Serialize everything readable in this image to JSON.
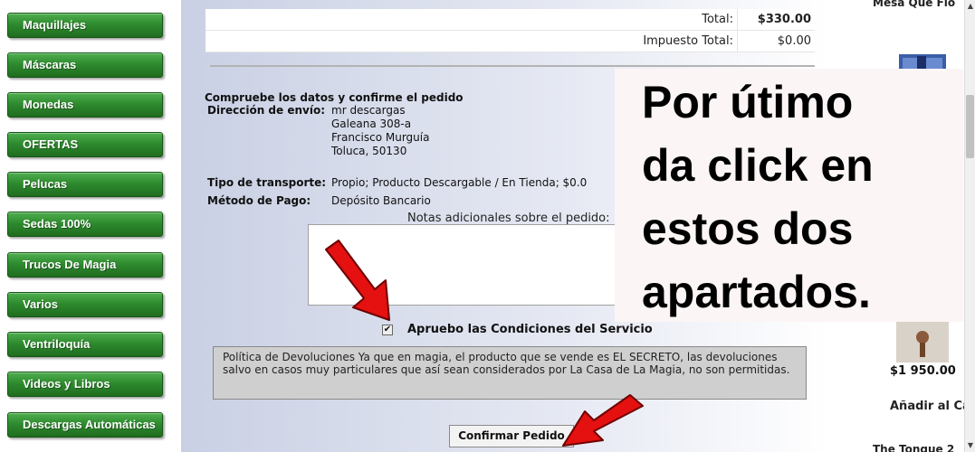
{
  "sidebar": {
    "items": [
      {
        "label": "Maquillajes"
      },
      {
        "label": "Máscaras"
      },
      {
        "label": "Monedas"
      },
      {
        "label": "OFERTAS"
      },
      {
        "label": "Pelucas"
      },
      {
        "label": "Sedas 100%"
      },
      {
        "label": "Trucos De Magia"
      },
      {
        "label": "Varios"
      },
      {
        "label": "Ventriloquía"
      },
      {
        "label": "Videos y Libros"
      },
      {
        "label": "Descargas Automáticas"
      }
    ]
  },
  "totals": {
    "total_label": "Total:",
    "total_value": "$330.00",
    "tax_label": "Impuesto Total:",
    "tax_value": "$0.00"
  },
  "confirm": {
    "title": "Compruebe los datos y confirme el pedido",
    "shipping_address_label": "Dirección de envío:",
    "shipping_address_lines": [
      "mr descargas",
      "Galeana 308-a",
      "Francisco Murguía",
      "Toluca, 50130"
    ],
    "transport_label": "Tipo de transporte:",
    "transport_value": "Propio; Producto Descargable / En Tienda; $0.0",
    "payment_label": "Método de Pago:",
    "payment_value": "Depósito Bancario",
    "notes_label": "Notas adicionales sobre el pedido:",
    "notes_value": "",
    "terms_checked": true,
    "terms_check_mark": "✔",
    "terms_label": "Apruebo las Condiciones del Servicio",
    "policy_text": "Política de Devoluciones Ya que en magia, el producto que se vende es EL SECRETO, las devoluciones salvo en casos muy particulares que así sean considerados por La Casa de La Magia, no son permitidas.",
    "confirm_button": "Confirmar Pedido"
  },
  "overlay": {
    "text": "Por útimo\nda click en\nestos dos\napartados."
  },
  "right_column": {
    "product_top_name": "Mesa Que Flo",
    "product_price": "$1 950.00",
    "add_to_cart": "Añadir al Car",
    "product_bottom_name": "The Tongue 2"
  },
  "scrollbar": {
    "up_icon": "▲",
    "down_icon": "▼"
  },
  "colors": {
    "sidebar_button": "#2e8b2e",
    "arrow": "#e51010",
    "overlay_bg": "#fcf5f5",
    "main_bg": "#c9d0e4"
  }
}
